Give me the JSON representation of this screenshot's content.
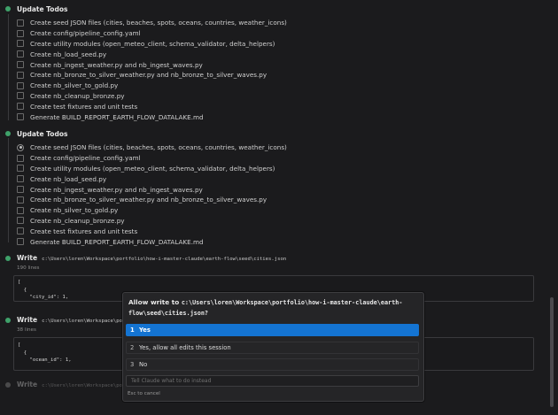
{
  "todos_1": {
    "heading": "Update Todos",
    "items": [
      "Create seed JSON files (cities, beaches, spots, oceans, countries, weather_icons)",
      "Create config/pipeline_config.yaml",
      "Create utility modules (open_meteo_client, schema_validator, delta_helpers)",
      "Create nb_load_seed.py",
      "Create nb_ingest_weather.py and nb_ingest_waves.py",
      "Create nb_bronze_to_silver_weather.py and nb_bronze_to_silver_waves.py",
      "Create nb_silver_to_gold.py",
      "Create nb_cleanup_bronze.py",
      "Create test fixtures and unit tests",
      "Generate BUILD_REPORT_EARTH_FLOW_DATALAKE.md"
    ]
  },
  "todos_2": {
    "heading": "Update Todos",
    "items": [
      "Create seed JSON files (cities, beaches, spots, oceans, countries, weather_icons)",
      "Create config/pipeline_config.yaml",
      "Create utility modules (open_meteo_client, schema_validator, delta_helpers)",
      "Create nb_load_seed.py",
      "Create nb_ingest_weather.py and nb_ingest_waves.py",
      "Create nb_bronze_to_silver_weather.py and nb_bronze_to_silver_waves.py",
      "Create nb_silver_to_gold.py",
      "Create nb_cleanup_bronze.py",
      "Create test fixtures and unit tests",
      "Generate BUILD_REPORT_EARTH_FLOW_DATALAKE.md"
    ]
  },
  "write_1": {
    "label": "Write",
    "path": "c:\\Users\\loren\\Workspace\\portfolio\\how-i-master-claude\\earth-flow\\seed\\cities.json",
    "lines": "190 lines",
    "code": [
      "[",
      "  {",
      "    \"city_id\": 1,"
    ]
  },
  "write_2": {
    "label": "Write",
    "path": "c:\\Users\\loren\\Workspace\\portfolio",
    "lines": "38 lines",
    "code": [
      "[",
      "  {",
      "    \"ocean_id\": 1,"
    ]
  },
  "write_3": {
    "label": "Write",
    "path": "c:\\Users\\loren\\Workspace\\portfolio"
  },
  "dialog": {
    "title_prefix": "Allow write to ",
    "title_path": "c:\\Users\\loren\\Workspace\\portfolio\\how-i-master-claude\\earth-flow\\seed\\cities.json?",
    "options": [
      {
        "num": "1",
        "label": "Yes"
      },
      {
        "num": "2",
        "label": "Yes, allow all edits this session"
      },
      {
        "num": "3",
        "label": "No"
      }
    ],
    "instruction_placeholder": "Tell Claude what to do instead",
    "esc_hint": "Esc to cancel"
  },
  "colors": {
    "background": "#1b1b1d",
    "accent": "#1474d2",
    "dot_done": "#3fa26a"
  }
}
